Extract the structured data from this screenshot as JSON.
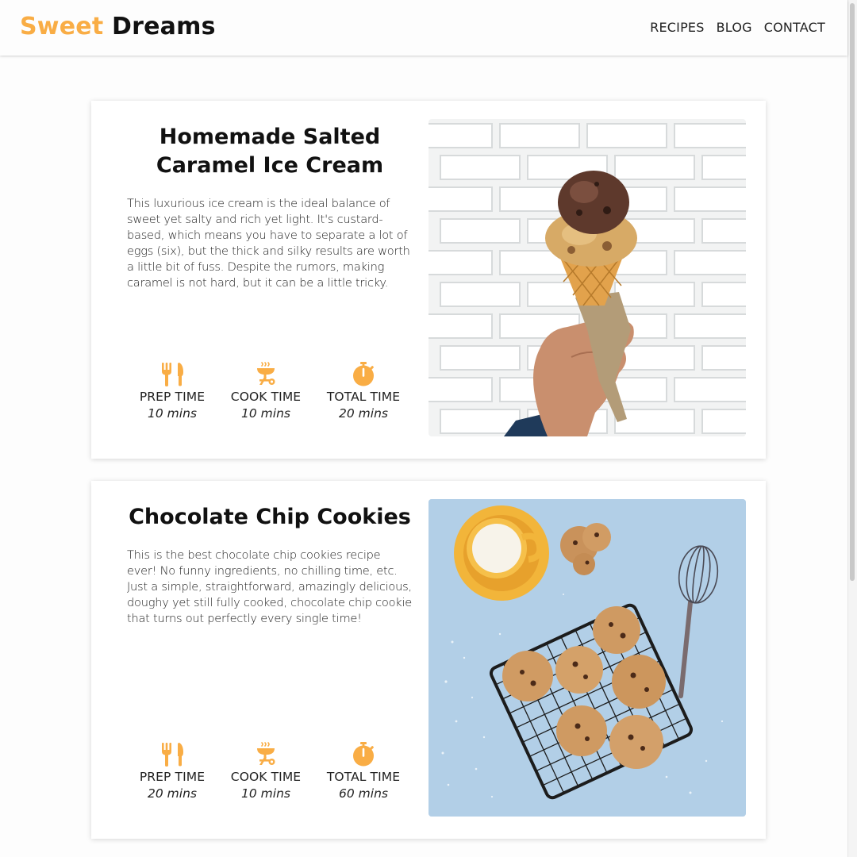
{
  "brand": {
    "part1": "Sweet",
    "part2": "Dreams"
  },
  "nav": [
    "RECIPES",
    "BLOG",
    "CONTACT"
  ],
  "colors": {
    "accent": "#f9ad45",
    "text": "#222222",
    "background": "#fdfdfd"
  },
  "recipes": [
    {
      "title": "Homemade Salted Caramel Ice Cream",
      "description": "This luxurious ice cream is the ideal balance of sweet yet salty and rich yet light. It's custard-based, which means you have to separate a lot of eggs (six), but the thick and silky results are worth a little bit of fuss. Despite the rumors, making caramel is not hard, but it can be a little tricky.",
      "stats": [
        {
          "icon": "fork-knife-icon",
          "label": "PREP TIME",
          "value": "10 mins"
        },
        {
          "icon": "grill-icon",
          "label": "COOK TIME",
          "value": "10 mins"
        },
        {
          "icon": "stopwatch-icon",
          "label": "TOTAL TIME",
          "value": "20 mins"
        }
      ],
      "image": "ice-cream-cone-photo"
    },
    {
      "title": "Chocolate Chip Cookies",
      "description": "This is the best chocolate chip cookies recipe ever! No funny ingredients, no chilling time, etc. Just a simple, straightforward, amazingly delicious, doughy yet still fully cooked, chocolate chip cookie that turns out perfectly every single time!",
      "stats": [
        {
          "icon": "fork-knife-icon",
          "label": "PREP TIME",
          "value": "20 mins"
        },
        {
          "icon": "grill-icon",
          "label": "COOK TIME",
          "value": "10 mins"
        },
        {
          "icon": "stopwatch-icon",
          "label": "TOTAL TIME",
          "value": "60 mins"
        }
      ],
      "image": "cookies-on-rack-photo"
    }
  ]
}
